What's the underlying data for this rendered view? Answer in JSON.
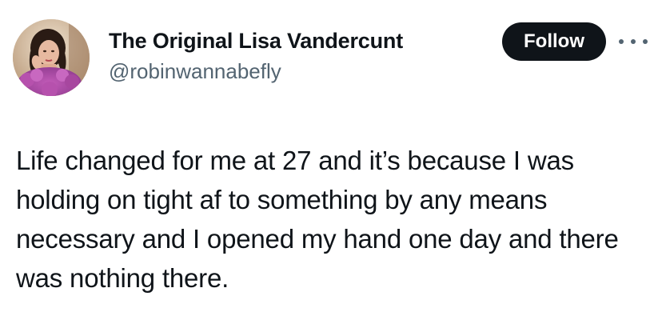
{
  "author": {
    "display_name": "The Original Lisa Vandercunt",
    "handle": "@robinwannabefly",
    "avatar_icon": "profile-photo"
  },
  "actions": {
    "follow_label": "Follow",
    "more_icon": "more-horizontal-icon"
  },
  "tweet": {
    "text": "Life changed for me at 27 and it’s because I was holding on tight af to something by any means necessary and I opened my hand one day and there was nothing there."
  },
  "colors": {
    "text_primary": "#0f1419",
    "text_secondary": "#536471",
    "follow_bg": "#0f1419",
    "follow_text": "#ffffff"
  }
}
